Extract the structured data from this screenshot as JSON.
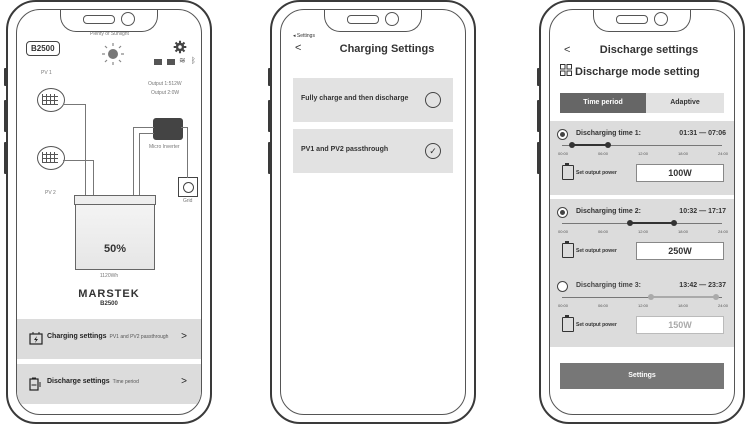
{
  "screen1": {
    "device": "B2500",
    "sun_label": "Plenty of Sunlight",
    "pv1": "PV 1",
    "pv2": "PV 2",
    "output1": "Output 1:512W",
    "output2": "Output 2:0W",
    "micro_inverter": "Micro Inverter",
    "grid": "Grid",
    "battery_pct": "50%",
    "capacity": "1120Wh",
    "brand": "MARSTEK",
    "model": "B2500",
    "charging": {
      "label": "Charging settings",
      "sub": "PV1 and PV2 passthrough",
      "chevron": ">"
    },
    "discharge": {
      "label": "Discharge settings",
      "sub": "Time period",
      "chevron": ">"
    }
  },
  "screen2": {
    "back_small": "◂ Settings",
    "back": "<",
    "title": "Charging Settings",
    "options": [
      {
        "label": "Fully charge and then discharge",
        "selected": false
      },
      {
        "label": "PV1 and PV2 passthrough",
        "selected": true
      }
    ],
    "check_glyph": "✓"
  },
  "screen3": {
    "back": "<",
    "title": "Discharge settings",
    "mode_title": "Discharge mode setting",
    "tabs": [
      "Time period",
      "Adaptive"
    ],
    "ticks": [
      "00:00",
      "06:00",
      "12:00",
      "18:00",
      "24:00"
    ],
    "set_output_label": "Set output power",
    "periods": [
      {
        "name": "Discharging time 1:",
        "range": "01:31 — 07:06",
        "power": "100W",
        "on": true,
        "start_h": 1.52,
        "end_h": 7.1
      },
      {
        "name": "Discharging time 2:",
        "range": "10:32 — 17:17",
        "power": "250W",
        "on": true,
        "start_h": 10.53,
        "end_h": 17.28
      },
      {
        "name": "Discharging time 3:",
        "range": "13:42 — 23:37",
        "power": "150W",
        "on": false,
        "start_h": 13.7,
        "end_h": 23.62
      }
    ],
    "settings_button": "Settings"
  }
}
